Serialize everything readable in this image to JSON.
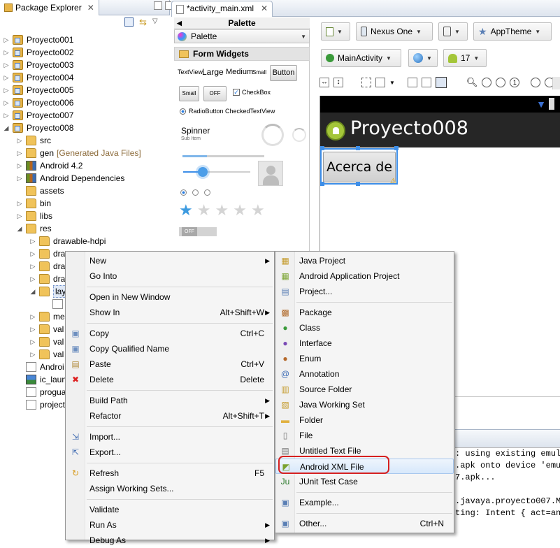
{
  "package_explorer": {
    "title": "Package Explorer",
    "tree": [
      {
        "label": "Proyecto001",
        "level": 0,
        "expander": "▷",
        "icon": "project-icon"
      },
      {
        "label": "Proyecto002",
        "level": 0,
        "expander": "▷",
        "icon": "project-icon"
      },
      {
        "label": "Proyecto003",
        "level": 0,
        "expander": "▷",
        "icon": "project-icon"
      },
      {
        "label": "Proyecto004",
        "level": 0,
        "expander": "▷",
        "icon": "project-icon"
      },
      {
        "label": "Proyecto005",
        "level": 0,
        "expander": "▷",
        "icon": "project-icon"
      },
      {
        "label": "Proyecto006",
        "level": 0,
        "expander": "▷",
        "icon": "project-icon"
      },
      {
        "label": "Proyecto007",
        "level": 0,
        "expander": "▷",
        "icon": "project-icon"
      },
      {
        "label": "Proyecto008",
        "level": 0,
        "expander": "◢",
        "icon": "project-icon"
      },
      {
        "label": "src",
        "level": 1,
        "expander": "▷",
        "icon": "folder-icon"
      },
      {
        "label": "gen",
        "suffix": "[Generated Java Files]",
        "level": 1,
        "expander": "▷",
        "icon": "folder-icon"
      },
      {
        "label": "Android 4.2",
        "level": 1,
        "expander": "▷",
        "icon": "library-icon"
      },
      {
        "label": "Android Dependencies",
        "level": 1,
        "expander": "▷",
        "icon": "library-icon"
      },
      {
        "label": "assets",
        "level": 1,
        "expander": "",
        "icon": "folder-icon"
      },
      {
        "label": "bin",
        "level": 1,
        "expander": "▷",
        "icon": "folder-icon"
      },
      {
        "label": "libs",
        "level": 1,
        "expander": "▷",
        "icon": "folder-icon"
      },
      {
        "label": "res",
        "level": 1,
        "expander": "◢",
        "icon": "folder-icon"
      },
      {
        "label": "drawable-hdpi",
        "level": 2,
        "expander": "▷",
        "icon": "folder-icon"
      },
      {
        "label": "dra",
        "level": 2,
        "expander": "▷",
        "icon": "folder-icon"
      },
      {
        "label": "dra",
        "level": 2,
        "expander": "▷",
        "icon": "folder-icon"
      },
      {
        "label": "dra",
        "level": 2,
        "expander": "▷",
        "icon": "folder-icon"
      },
      {
        "label": "lay",
        "level": 2,
        "expander": "◢",
        "icon": "folder-icon",
        "selected": true
      },
      {
        "label": "",
        "level": 3,
        "expander": "",
        "icon": "xml-file-icon"
      },
      {
        "label": "me",
        "level": 2,
        "expander": "▷",
        "icon": "folder-icon"
      },
      {
        "label": "val",
        "level": 2,
        "expander": "▷",
        "icon": "folder-icon"
      },
      {
        "label": "val",
        "level": 2,
        "expander": "▷",
        "icon": "folder-icon"
      },
      {
        "label": "val",
        "level": 2,
        "expander": "▷",
        "icon": "folder-icon"
      },
      {
        "label": "Androi",
        "level": 1,
        "expander": "",
        "icon": "manifest-icon"
      },
      {
        "label": "ic_laun",
        "level": 1,
        "expander": "",
        "icon": "image-icon"
      },
      {
        "label": "progua",
        "level": 1,
        "expander": "",
        "icon": "file-icon"
      },
      {
        "label": "project",
        "level": 1,
        "expander": "",
        "icon": "file-icon"
      }
    ]
  },
  "editor": {
    "tab_label": "*activity_main.xml",
    "palette": {
      "title": "Palette",
      "combo_label": "Palette",
      "section": "Form Widgets",
      "textview_row": [
        "TextView",
        "Large",
        "Medium",
        "Small",
        "Button"
      ],
      "small_button": "Small",
      "toggle_off": "OFF",
      "checkbox": "CheckBox",
      "radio_row": "RadioButton CheckedTextView",
      "spinner": "Spinner",
      "spinner_sub": "Sub Item",
      "switch_off": "OFF",
      "rating_stars": 5,
      "rating_filled": 1
    },
    "toolbar": {
      "device": "Nexus One",
      "theme": "AppTheme",
      "activity": "MainActivity",
      "api": "17"
    },
    "device_preview": {
      "app_title": "Proyecto008",
      "button_text": "Acerca de"
    },
    "console_lines": [
      ": using existing emula",
      ".apk onto device 'emul",
      "7.apk...",
      "",
      ".javaya.proyecto007.Ma",
      "ting: Intent { act=and"
    ]
  },
  "context_menu": {
    "items": [
      {
        "label": "New",
        "submenu": true
      },
      {
        "label": "Go Into"
      },
      {
        "sep": true
      },
      {
        "label": "Open in New Window"
      },
      {
        "label": "Show In",
        "shortcut": "Alt+Shift+W",
        "submenu": true
      },
      {
        "sep": true
      },
      {
        "label": "Copy",
        "shortcut": "Ctrl+C",
        "icon": "copy-icon"
      },
      {
        "label": "Copy Qualified Name",
        "icon": "copy-icon"
      },
      {
        "label": "Paste",
        "shortcut": "Ctrl+V",
        "icon": "paste-icon"
      },
      {
        "label": "Delete",
        "shortcut": "Delete",
        "icon": "delete-icon"
      },
      {
        "sep": true
      },
      {
        "label": "Build Path",
        "submenu": true
      },
      {
        "label": "Refactor",
        "shortcut": "Alt+Shift+T",
        "submenu": true
      },
      {
        "sep": true
      },
      {
        "label": "Import...",
        "icon": "import-icon"
      },
      {
        "label": "Export...",
        "icon": "export-icon"
      },
      {
        "sep": true
      },
      {
        "label": "Refresh",
        "shortcut": "F5",
        "icon": "refresh-icon"
      },
      {
        "label": "Assign Working Sets..."
      },
      {
        "sep": true
      },
      {
        "label": "Validate"
      },
      {
        "label": "Run As",
        "submenu": true
      },
      {
        "label": "Debug As",
        "submenu": true
      }
    ]
  },
  "new_submenu": {
    "items": [
      {
        "label": "Java Project",
        "icon": "java-project-icon"
      },
      {
        "label": "Android Application Project",
        "icon": "android-project-icon"
      },
      {
        "label": "Project...",
        "icon": "project-wizard-icon"
      },
      {
        "sep": true
      },
      {
        "label": "Package",
        "icon": "package-icon"
      },
      {
        "label": "Class",
        "icon": "class-icon"
      },
      {
        "label": "Interface",
        "icon": "interface-icon"
      },
      {
        "label": "Enum",
        "icon": "enum-icon"
      },
      {
        "label": "Annotation",
        "icon": "annotation-icon"
      },
      {
        "label": "Source Folder",
        "icon": "source-folder-icon"
      },
      {
        "label": "Java Working Set",
        "icon": "working-set-icon"
      },
      {
        "label": "Folder",
        "icon": "folder-icon"
      },
      {
        "label": "File",
        "icon": "file-icon"
      },
      {
        "label": "Untitled Text File",
        "icon": "text-file-icon"
      },
      {
        "label": "Android XML File",
        "icon": "android-xml-icon",
        "highlighted": true
      },
      {
        "label": "JUnit Test Case",
        "icon": "junit-icon"
      },
      {
        "sep": true
      },
      {
        "label": "Example...",
        "icon": "example-icon"
      },
      {
        "sep": true
      },
      {
        "label": "Other...",
        "shortcut": "Ctrl+N",
        "icon": "other-icon"
      }
    ]
  },
  "colors": {
    "highlight_ring": "#d62020",
    "selection_blue": "#3d8ee8",
    "android_green": "#a4c639"
  }
}
